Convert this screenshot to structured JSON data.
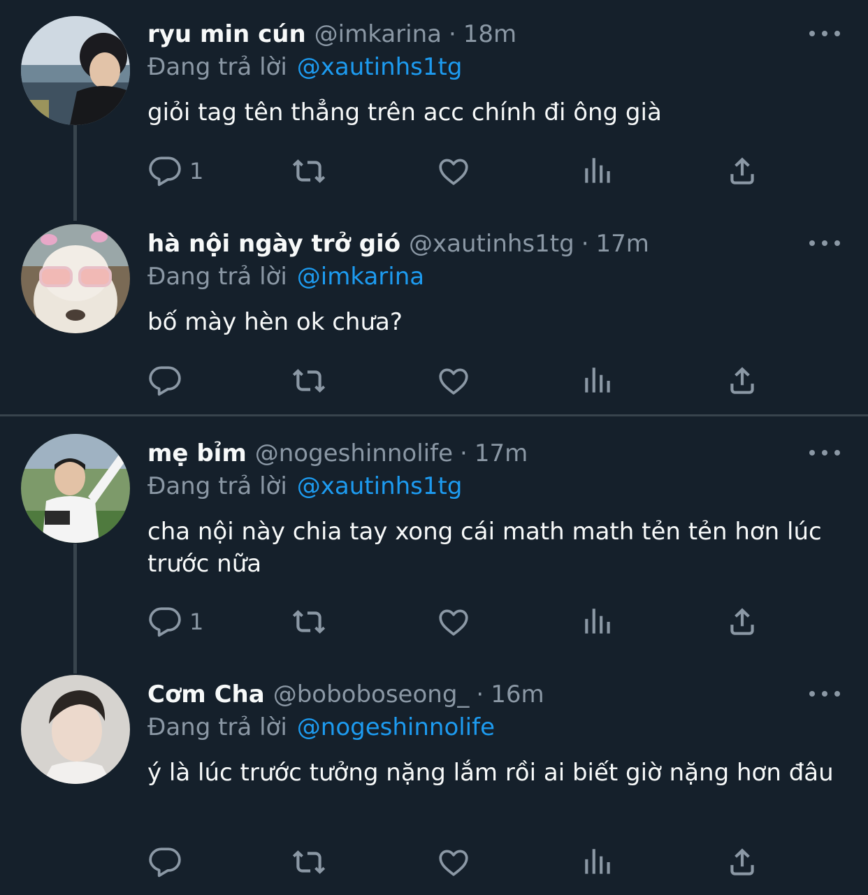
{
  "colors": {
    "background": "#15202b",
    "accent": "#1d9bf0",
    "secondary": "#8b98a5",
    "divider": "#38444d"
  },
  "tweets": [
    {
      "name": "ryu min cún",
      "handle": "@imkarina",
      "dot": "·",
      "time": "18m",
      "replying_label": "Đang trả lời",
      "replying_to": "@xautinhs1tg",
      "text": "giỏi tag tên thẳng trên acc chính đi ông già",
      "reply_count": "1"
    },
    {
      "name": "hà nội ngày trở gió",
      "handle": "@xautinhs1tg",
      "dot": "·",
      "time": "17m",
      "replying_label": "Đang trả lời",
      "replying_to": "@imkarina",
      "text": "bố mày hèn ok chưa?",
      "reply_count": ""
    },
    {
      "name": "mẹ bỉm",
      "handle": "@nogeshinnolife",
      "dot": "·",
      "time": "17m",
      "replying_label": "Đang trả lời",
      "replying_to": "@xautinhs1tg",
      "text": "cha nội này chia tay xong cái math math tẻn tẻn hơn lúc trước nữa",
      "reply_count": "1"
    },
    {
      "name": "Cơm Cha",
      "handle": "@boboboseong_",
      "dot": "·",
      "time": "16m",
      "replying_label": "Đang trả lời",
      "replying_to": "@nogeshinnolife",
      "text": "ý là lúc trước tưởng nặng lắm rồi ai biết giờ nặng hơn đâu",
      "reply_count": ""
    }
  ],
  "icons": [
    "reply-icon",
    "retweet-icon",
    "like-icon",
    "views-icon",
    "share-icon",
    "more-icon"
  ]
}
